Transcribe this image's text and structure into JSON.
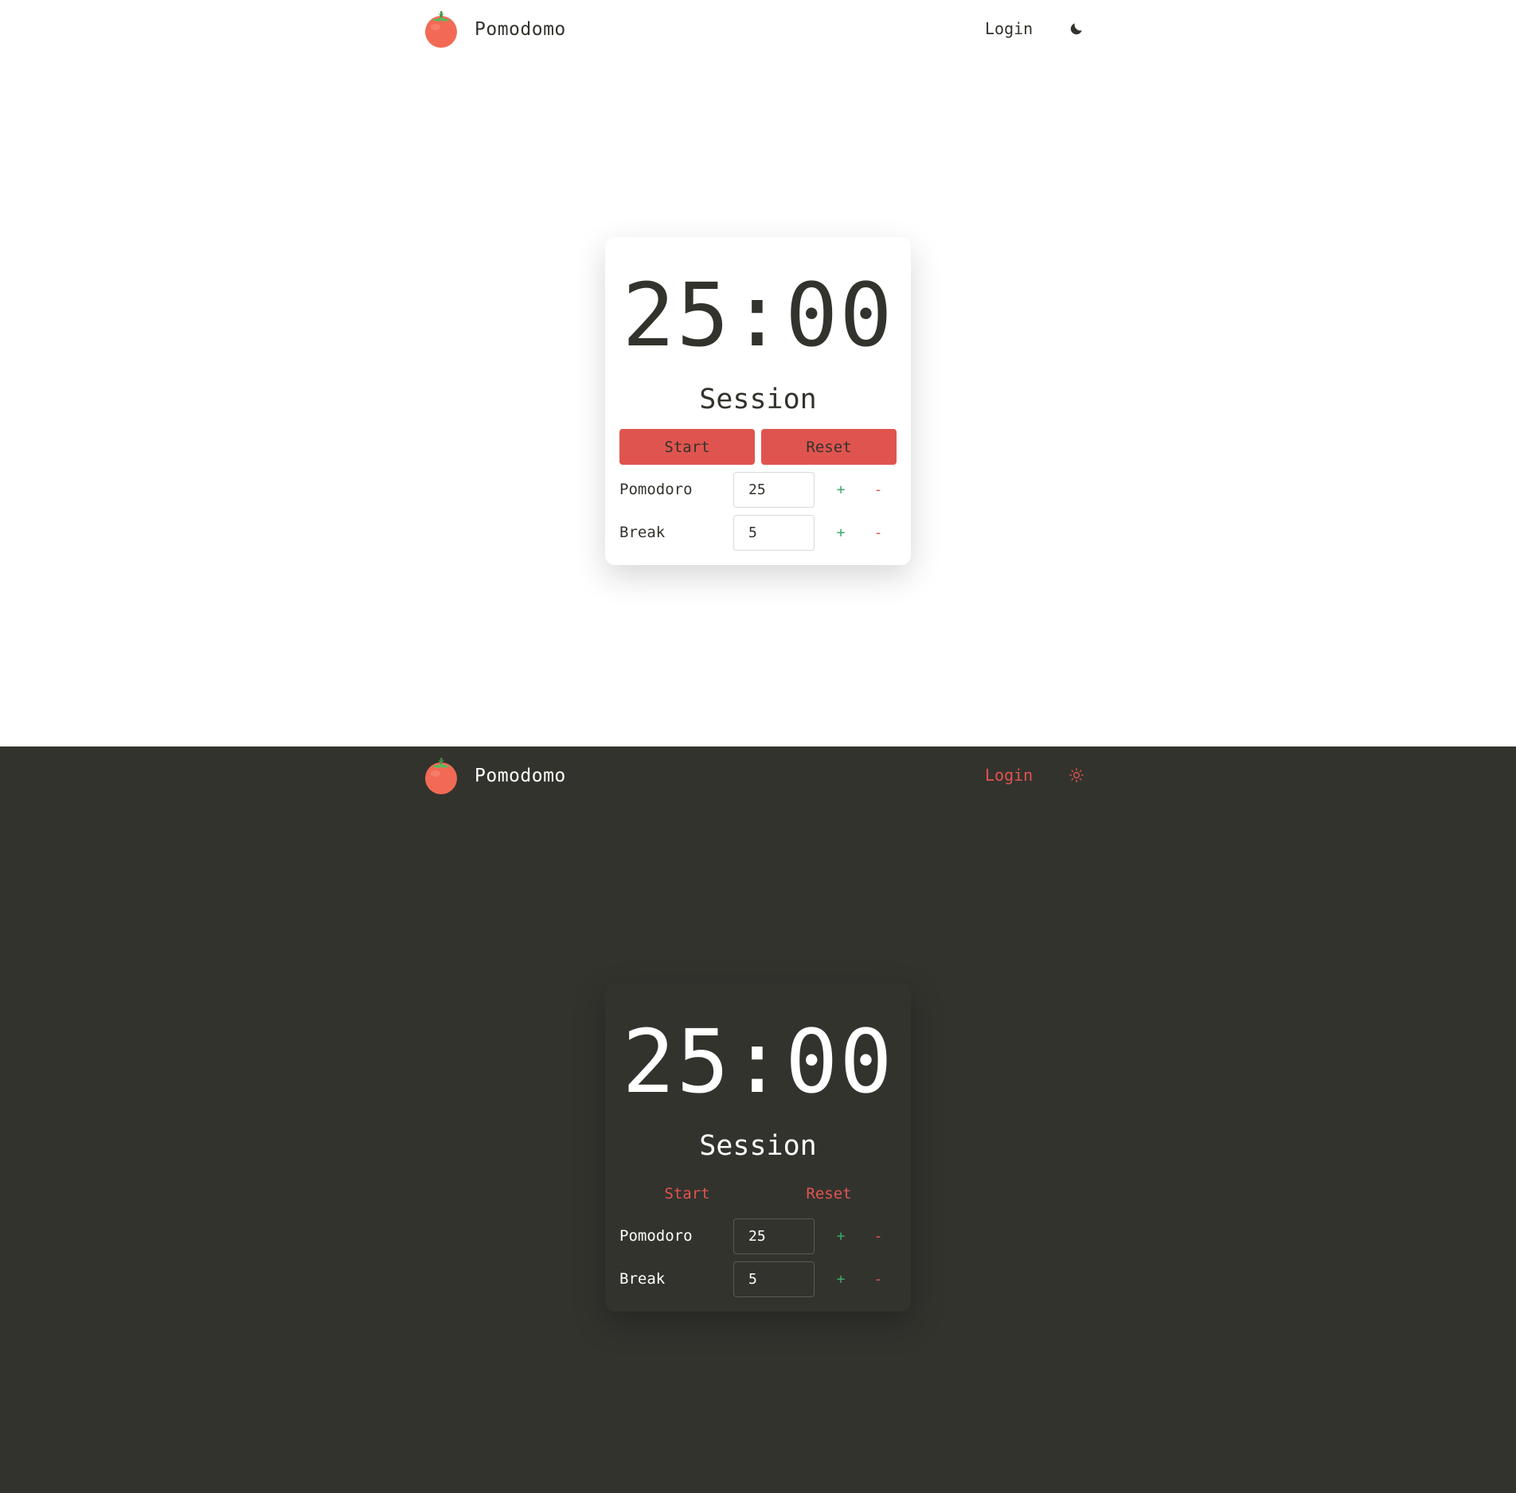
{
  "brand": {
    "name": "Pomodomo",
    "logo_icon": "tomato-icon"
  },
  "colors": {
    "light_bg": "#ffffff",
    "dark_bg": "#33332e",
    "text_dark": "#33332d",
    "accent_red": "#e0544f",
    "plus_green": "#3daa6a"
  },
  "light": {
    "nav": {
      "login": "Login",
      "theme_icon": "moon-icon"
    },
    "timer": "25:00",
    "mode": "Session",
    "buttons": {
      "start": "Start",
      "reset": "Reset"
    },
    "settings": [
      {
        "label": "Pomodoro",
        "value": "25",
        "plus": "+",
        "minus": "-"
      },
      {
        "label": "Break",
        "value": "5",
        "plus": "+",
        "minus": "-"
      }
    ]
  },
  "dark": {
    "nav": {
      "login": "Login",
      "theme_icon": "sun-icon"
    },
    "timer": "25:00",
    "mode": "Session",
    "buttons": {
      "start": "Start",
      "reset": "Reset"
    },
    "settings": [
      {
        "label": "Pomodoro",
        "value": "25",
        "plus": "+",
        "minus": "-"
      },
      {
        "label": "Break",
        "value": "5",
        "plus": "+",
        "minus": "-"
      }
    ]
  }
}
